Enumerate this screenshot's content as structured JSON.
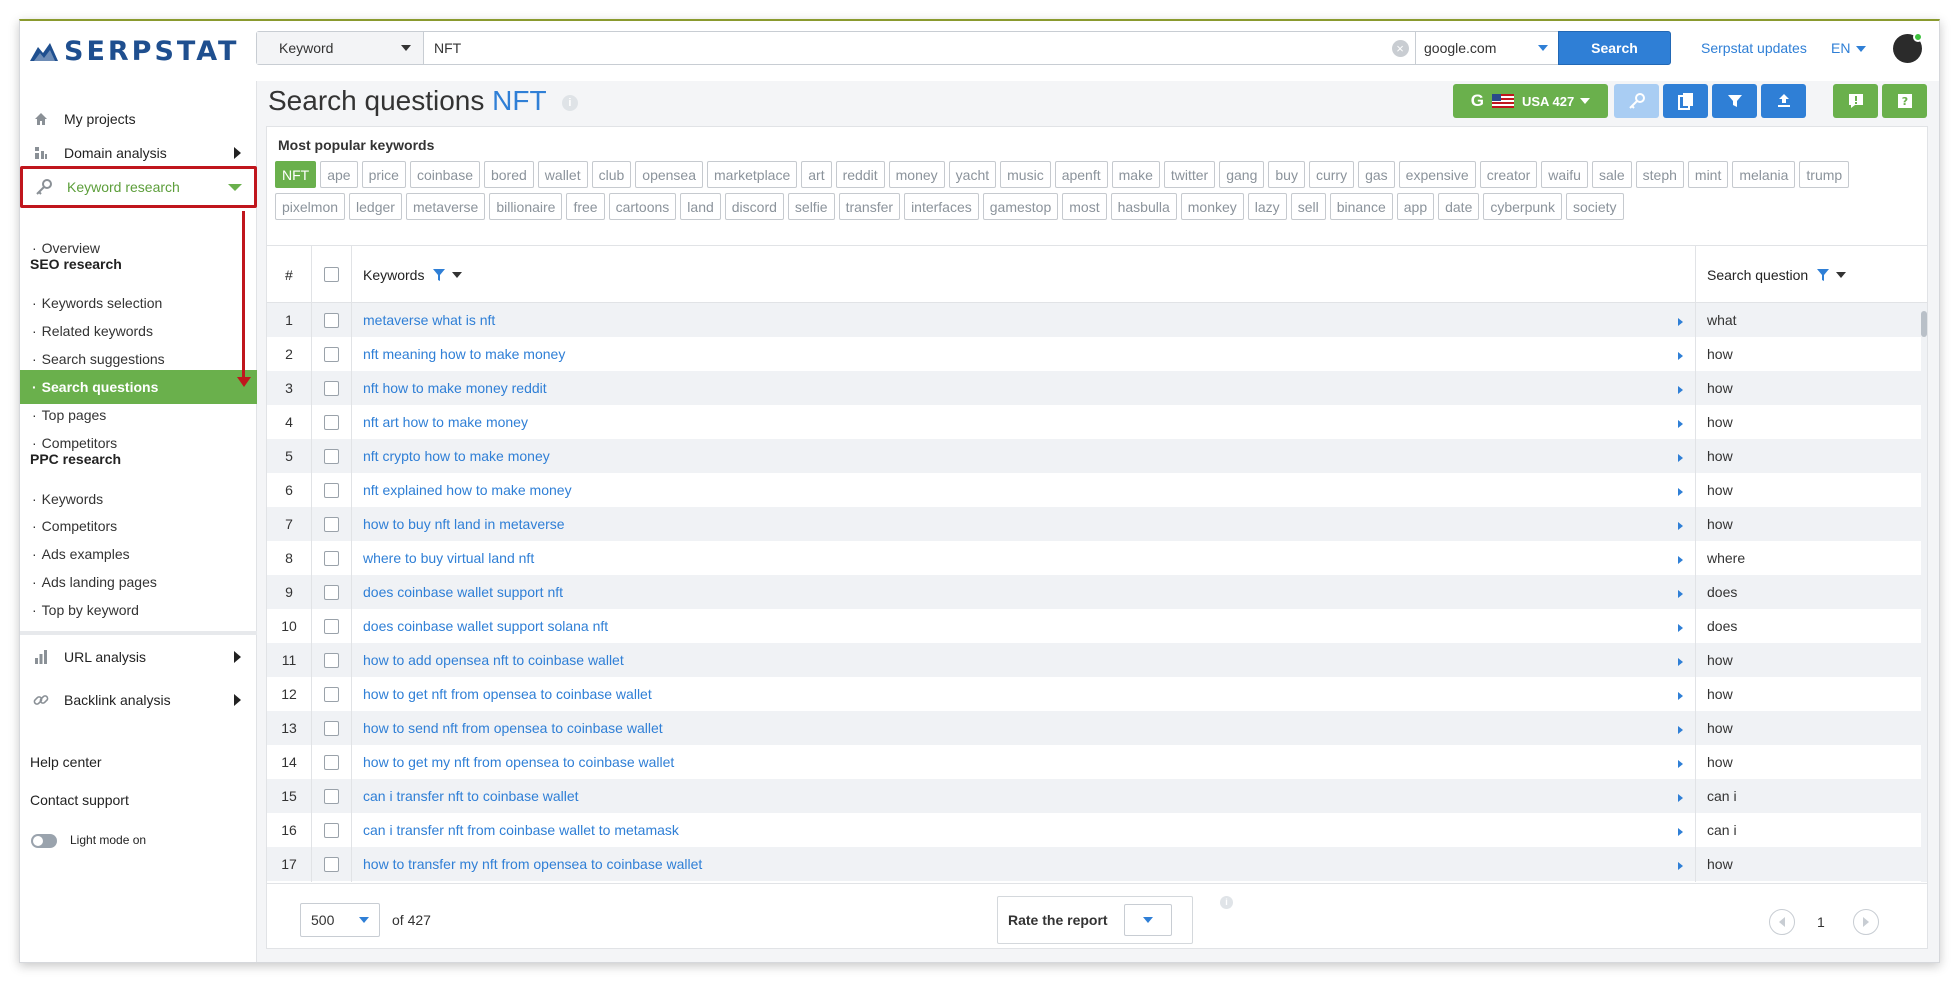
{
  "header": {
    "logo_text": "SERPSTAT",
    "search_type": "Keyword",
    "search_value": "NFT",
    "search_domain": "google.com",
    "search_button": "Search",
    "updates_link": "Serpstat updates",
    "language": "EN"
  },
  "sidebar": {
    "main_items": [
      {
        "label": "My projects",
        "icon": "home-icon"
      },
      {
        "label": "Domain analysis",
        "icon": "domain-chart-icon"
      },
      {
        "label": "Keyword research",
        "icon": "key-icon"
      }
    ],
    "keyword_sub": {
      "overview": "Overview",
      "seo_heading": "SEO research",
      "seo_items": [
        "Keywords selection",
        "Related keywords",
        "Search suggestions",
        "Search questions",
        "Top pages",
        "Competitors"
      ],
      "ppc_heading": "PPC research",
      "ppc_items": [
        "Keywords",
        "Competitors",
        "Ads examples",
        "Ads landing pages",
        "Top by keyword"
      ]
    },
    "lower_items": [
      {
        "label": "URL analysis",
        "icon": "bar-chart-icon"
      },
      {
        "label": "Backlink analysis",
        "icon": "link-icon"
      }
    ],
    "help_center": "Help center",
    "contact_support": "Contact support",
    "light_mode": "Light mode on"
  },
  "main": {
    "title_prefix": "Search questions",
    "title_keyword": "NFT",
    "region_button": "USA 427",
    "popular_heading": "Most popular keywords",
    "chips": [
      "NFT",
      "ape",
      "price",
      "coinbase",
      "bored",
      "wallet",
      "club",
      "opensea",
      "marketplace",
      "art",
      "reddit",
      "money",
      "yacht",
      "music",
      "apenft",
      "make",
      "twitter",
      "gang",
      "buy",
      "curry",
      "gas",
      "expensive",
      "creator",
      "waifu",
      "sale",
      "steph",
      "mint",
      "melania",
      "trump",
      "pixelmon",
      "ledger",
      "metaverse",
      "billionaire",
      "free",
      "cartoons",
      "land",
      "discord",
      "selfie",
      "transfer",
      "interfaces",
      "gamestop",
      "most",
      "hasbulla",
      "monkey",
      "lazy",
      "sell",
      "binance",
      "app",
      "date",
      "cyberpunk",
      "society"
    ],
    "table": {
      "col_num": "#",
      "col_keywords": "Keywords",
      "col_question": "Search question",
      "rows": [
        {
          "num": "1",
          "keyword": "metaverse what is nft",
          "question": "what"
        },
        {
          "num": "2",
          "keyword": "nft meaning how to make money",
          "question": "how"
        },
        {
          "num": "3",
          "keyword": "nft how to make money reddit",
          "question": "how"
        },
        {
          "num": "4",
          "keyword": "nft art how to make money",
          "question": "how"
        },
        {
          "num": "5",
          "keyword": "nft crypto how to make money",
          "question": "how"
        },
        {
          "num": "6",
          "keyword": "nft explained how to make money",
          "question": "how"
        },
        {
          "num": "7",
          "keyword": "how to buy nft land in metaverse",
          "question": "how"
        },
        {
          "num": "8",
          "keyword": "where to buy virtual land nft",
          "question": "where"
        },
        {
          "num": "9",
          "keyword": "does coinbase wallet support nft",
          "question": "does"
        },
        {
          "num": "10",
          "keyword": "does coinbase wallet support solana nft",
          "question": "does"
        },
        {
          "num": "11",
          "keyword": "how to add opensea nft to coinbase wallet",
          "question": "how"
        },
        {
          "num": "12",
          "keyword": "how to get nft from opensea to coinbase wallet",
          "question": "how"
        },
        {
          "num": "13",
          "keyword": "how to send nft from opensea to coinbase wallet",
          "question": "how"
        },
        {
          "num": "14",
          "keyword": "how to get my nft from opensea to coinbase wallet",
          "question": "how"
        },
        {
          "num": "15",
          "keyword": "can i transfer nft to coinbase wallet",
          "question": "can i"
        },
        {
          "num": "16",
          "keyword": "can i transfer nft from coinbase wallet to metamask",
          "question": "can i"
        },
        {
          "num": "17",
          "keyword": "how to transfer my nft from opensea to coinbase wallet",
          "question": "how"
        }
      ]
    },
    "footer": {
      "per_page": "500",
      "of_total": "of 427",
      "rate_label": "Rate the report",
      "page": "1"
    }
  },
  "colors": {
    "accent_blue": "#2f7fd6",
    "accent_green": "#6ab04c",
    "annotation_red": "#c0161d"
  }
}
